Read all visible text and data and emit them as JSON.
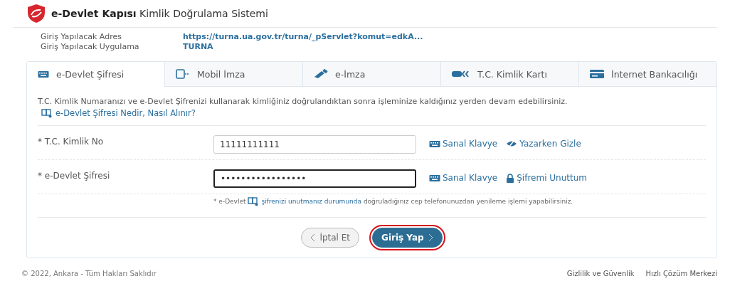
{
  "header": {
    "brand": "e-Devlet Kapısı",
    "title": "Kimlik Doğrulama Sistemi"
  },
  "info": [
    {
      "label": "Giriş Yapılacak Adres",
      "value": "https://turna.ua.gov.tr/turna/_pServlet?komut=edkA..."
    },
    {
      "label": "Giriş Yapılacak Uygulama",
      "value": "TURNA"
    }
  ],
  "tabs": [
    {
      "label": "e-Devlet Şifresi",
      "kind": "keyboard",
      "selected": true
    },
    {
      "label": "Mobil İmza",
      "kind": "mobile",
      "selected": false
    },
    {
      "label": "e-İmza",
      "kind": "usb",
      "selected": false
    },
    {
      "label": "T.C. Kimlik Kartı",
      "kind": "tck",
      "selected": false
    },
    {
      "label": "İnternet Bankacılığı",
      "kind": "card",
      "selected": false
    }
  ],
  "intro": "T.C. Kimlik Numaranızı ve e-Devlet Şifrenizi kullanarak kimliğiniz doğrulandıktan sonra işleminize kaldığınız yerden devam edebilirsiniz.",
  "help_link": "e-Devlet Şifresi Nedir, Nasıl Alınır?",
  "fields": [
    {
      "label": "* T.C. Kimlik No",
      "value": "11111111111",
      "focused": false,
      "actions": [
        {
          "kind": "keyboard",
          "label": "Sanal Klavye"
        },
        {
          "kind": "eye",
          "label": "Yazarken Gizle"
        }
      ]
    },
    {
      "label": "* e-Devlet Şifresi",
      "value": "•••••••••••••••••",
      "focused": true,
      "actions": [
        {
          "kind": "keyboard",
          "label": "Sanal Klavye"
        },
        {
          "kind": "lock",
          "label": "Şifremi Unuttum"
        }
      ]
    }
  ],
  "note": {
    "prefix": "* e-Devlet",
    "link": "şifrenizi unutmanız durumunda",
    "suffix": "doğruladığınız cep telefonunuzdan yenileme işlemi yapabilirsiniz."
  },
  "buttons": [
    {
      "label": "İptal Et",
      "kind": "secondary",
      "highlighted": false
    },
    {
      "label": "Giriş Yap",
      "kind": "primary",
      "highlighted": true
    }
  ],
  "footer": {
    "copyright": "© 2022, Ankara - Tüm Hakları Saklıdır",
    "links": [
      "Gizlilik ve Güvenlik",
      "Hızlı Çözüm Merkezi"
    ]
  }
}
